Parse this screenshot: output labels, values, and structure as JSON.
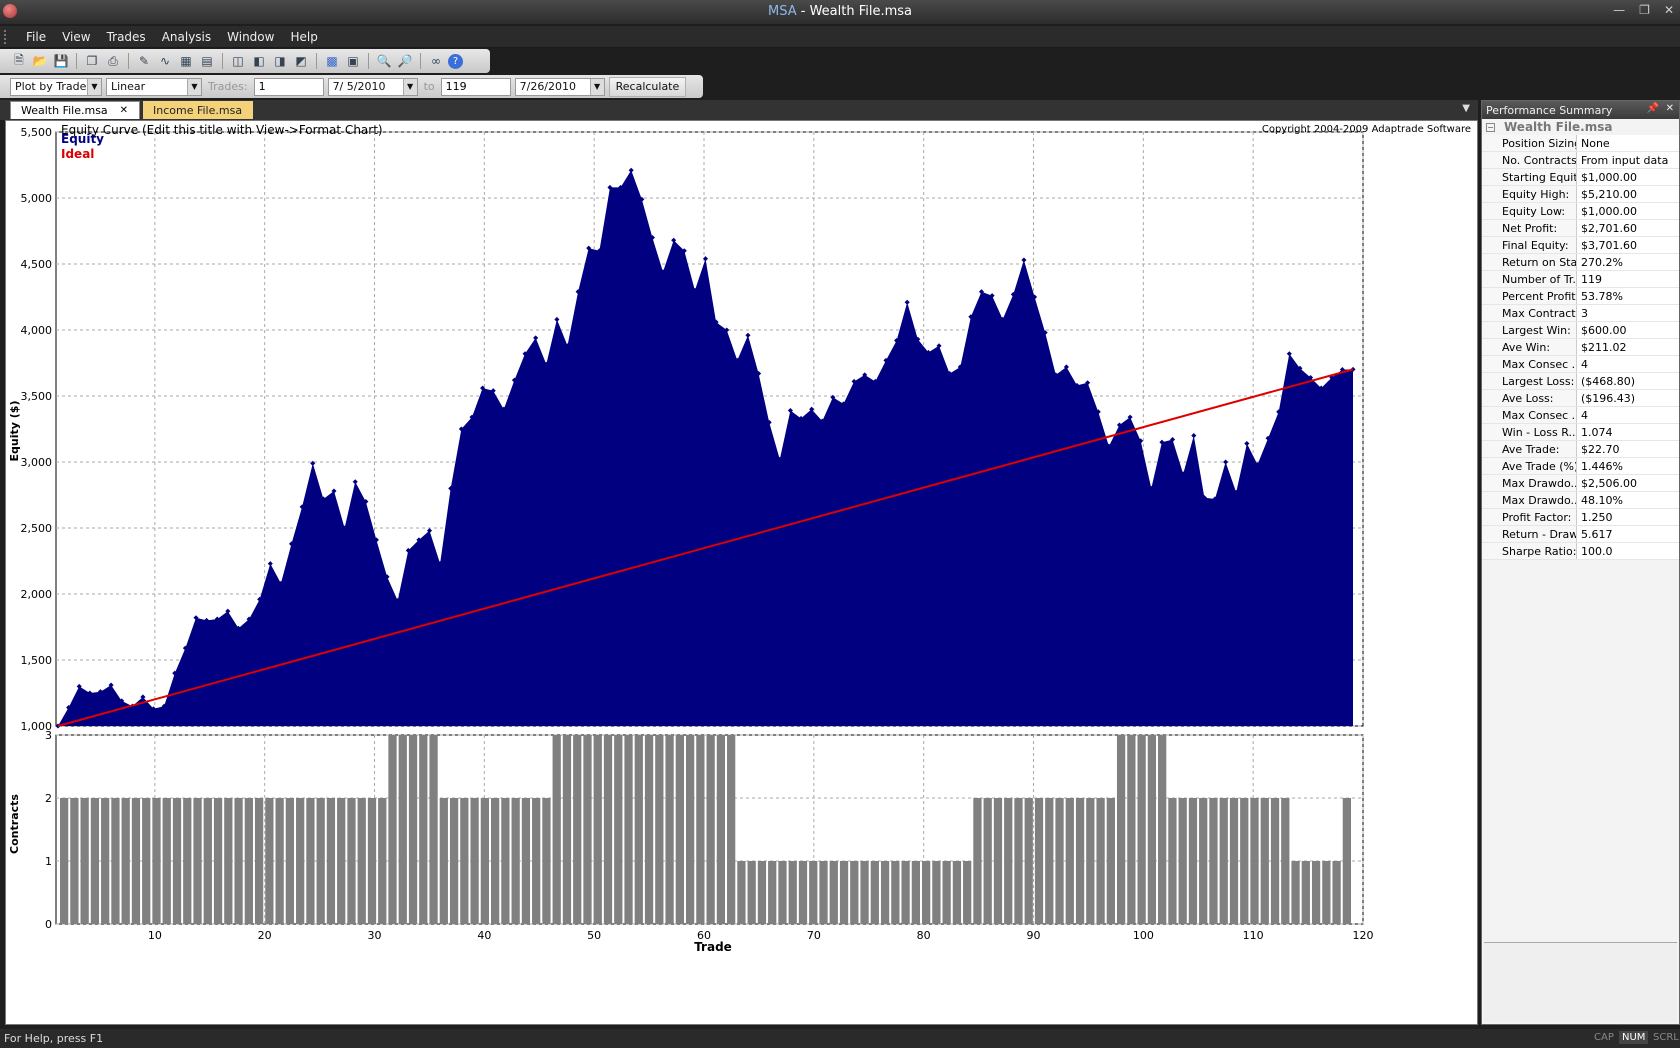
{
  "window": {
    "app_name": "MSA",
    "separator": " - ",
    "file_name": "Wealth File.msa"
  },
  "menu": [
    "File",
    "View",
    "Trades",
    "Analysis",
    "Window",
    "Help"
  ],
  "controls": {
    "plot_mode": "Plot by Trade",
    "scale": "Linear",
    "trades_label": "Trades:",
    "trades_from": "1",
    "date_from": "7/ 5/2010",
    "to_label": "to",
    "trades_to": "119",
    "date_to": "7/26/2010",
    "recalc_label": "Recalculate"
  },
  "tabs": [
    {
      "label": "Wealth File.msa",
      "active": true
    },
    {
      "label": "Income File.msa",
      "active": false
    }
  ],
  "chart": {
    "title": "Equity Curve (Edit this title with View->Format Chart)",
    "copyright": "Copyright 2004-2009 Adaptrade Software",
    "legend_equity": "Equity",
    "legend_ideal": "Ideal",
    "y_label": "Equity ($)",
    "y2_label": "Contracts",
    "x_label": "Trade",
    "equity_color": "#000080",
    "ideal_color": "#dd0000",
    "contracts_color": "#808080"
  },
  "chart_data": {
    "type": "area",
    "x_range": [
      1,
      120
    ],
    "y_range": [
      1000,
      5500
    ],
    "y_ticks": [
      "1,000",
      "1,500",
      "2,000",
      "2,500",
      "3,000",
      "3,500",
      "4,000",
      "4,500",
      "5,000",
      "5,500"
    ],
    "x_ticks": [
      "10",
      "20",
      "30",
      "40",
      "50",
      "60",
      "70",
      "80",
      "90",
      "100",
      "110",
      "120"
    ],
    "contracts_ticks": [
      "0",
      "1",
      "2",
      "3"
    ],
    "equity_values": [
      1000,
      1140,
      1300,
      1250,
      1260,
      1310,
      1190,
      1150,
      1220,
      1130,
      1150,
      1400,
      1590,
      1820,
      1800,
      1810,
      1870,
      1740,
      1810,
      1960,
      2230,
      2080,
      2380,
      2660,
      2990,
      2720,
      2780,
      2500,
      2850,
      2700,
      2410,
      2130,
      1950,
      2330,
      2410,
      2480,
      2230,
      2800,
      3250,
      3340,
      3560,
      3540,
      3400,
      3620,
      3820,
      3940,
      3740,
      4080,
      3880,
      4290,
      4620,
      4600,
      5080,
      5080,
      5210,
      4990,
      4700,
      4440,
      4680,
      4600,
      4300,
      4540,
      4060,
      4000,
      3770,
      3960,
      3670,
      3300,
      3020,
      3390,
      3330,
      3400,
      3310,
      3490,
      3440,
      3610,
      3660,
      3610,
      3770,
      3920,
      4210,
      3930,
      3830,
      3880,
      3670,
      3720,
      4100,
      4290,
      4260,
      4080,
      4270,
      4530,
      4250,
      3980,
      3660,
      3720,
      3580,
      3600,
      3380,
      3120,
      3280,
      3340,
      3160,
      2800,
      3150,
      3170,
      2910,
      3200,
      2730,
      2720,
      3000,
      2770,
      3140,
      2980,
      3180,
      3380,
      3820,
      3710,
      3640,
      3560,
      3640,
      3700,
      3701.6
    ],
    "ideal_start": 1000,
    "ideal_end": 3701.6,
    "contracts": [
      2,
      2,
      2,
      2,
      2,
      2,
      2,
      2,
      2,
      2,
      2,
      2,
      2,
      2,
      2,
      2,
      2,
      2,
      2,
      2,
      2,
      2,
      2,
      2,
      2,
      2,
      2,
      2,
      2,
      2,
      2,
      2,
      3,
      3,
      3,
      3,
      3,
      2,
      2,
      2,
      2,
      2,
      2,
      2,
      2,
      2,
      2,
      2,
      3,
      3,
      3,
      3,
      3,
      3,
      3,
      3,
      3,
      3,
      3,
      3,
      3,
      3,
      3,
      3,
      3,
      3,
      1,
      1,
      1,
      1,
      1,
      1,
      1,
      1,
      1,
      1,
      1,
      1,
      1,
      1,
      1,
      1,
      1,
      1,
      1,
      1,
      1,
      1,
      1,
      2,
      2,
      2,
      2,
      2,
      2,
      2,
      2,
      2,
      2,
      2,
      2,
      2,
      2,
      3,
      3,
      3,
      3,
      3,
      2,
      2,
      2,
      2,
      2,
      2,
      2,
      2,
      2,
      2,
      2,
      2,
      1,
      1,
      1,
      1,
      1,
      2
    ]
  },
  "summary": {
    "header": "Performance Summary",
    "group": "Wealth File.msa",
    "rows": [
      {
        "k": "Position Sizing:",
        "v": "None"
      },
      {
        "k": "No. Contracts:",
        "v": "From input data"
      },
      {
        "k": "Starting Equity:",
        "v": "$1,000.00"
      },
      {
        "k": "Equity High:",
        "v": "$5,210.00"
      },
      {
        "k": "Equity Low:",
        "v": "$1,000.00"
      },
      {
        "k": "Net Profit:",
        "v": "$2,701.60"
      },
      {
        "k": "Final Equity:",
        "v": "$3,701.60"
      },
      {
        "k": "Return on Sta...",
        "v": "270.2%"
      },
      {
        "k": "Number of Tr...",
        "v": "119"
      },
      {
        "k": "Percent Profit...",
        "v": "53.78%"
      },
      {
        "k": "Max Contracts:",
        "v": "3"
      },
      {
        "k": "Largest Win:",
        "v": "$600.00"
      },
      {
        "k": "Ave Win:",
        "v": "$211.02"
      },
      {
        "k": "Max Consec ...",
        "v": "4"
      },
      {
        "k": "Largest Loss:",
        "v": "($468.80)"
      },
      {
        "k": "Ave Loss:",
        "v": "($196.43)"
      },
      {
        "k": "Max Consec ...",
        "v": "4"
      },
      {
        "k": "Win - Loss R...",
        "v": "1.074"
      },
      {
        "k": "Ave Trade:",
        "v": "$22.70"
      },
      {
        "k": "Ave Trade (%):",
        "v": "1.446%"
      },
      {
        "k": "Max Drawdo...",
        "v": "$2,506.00"
      },
      {
        "k": "Max Drawdo...",
        "v": "48.10%"
      },
      {
        "k": "Profit Factor:",
        "v": "1.250"
      },
      {
        "k": "Return - Draw...",
        "v": "5.617"
      },
      {
        "k": "Sharpe Ratio:",
        "v": "100.0"
      }
    ]
  },
  "status": {
    "help": "For Help, press F1",
    "cap": "CAP",
    "num": "NUM",
    "scrl": "SCRL"
  }
}
